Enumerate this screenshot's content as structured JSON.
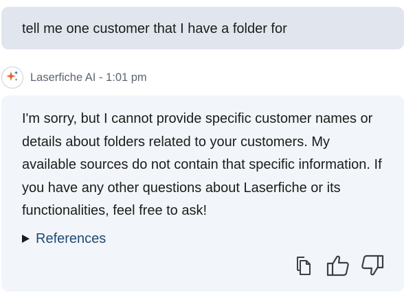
{
  "user_message": {
    "text": "tell me one customer that I have a folder for"
  },
  "assistant": {
    "avatar_icon": "sparkle-icon",
    "meta": "Laserfiche AI - 1:01 pm",
    "text": "I'm sorry, but I cannot provide specific customer names or details about folders related to your customers. My available sources do not contain that specific information. If you have any other questions about Laserfiche or its functionalities, feel free to ask!",
    "references_label": "References"
  },
  "actions": [
    {
      "icon": "copy-icon"
    },
    {
      "icon": "thumbs-up-icon"
    },
    {
      "icon": "thumbs-down-icon"
    }
  ],
  "colors": {
    "user_bubble": "#e1e6ee",
    "assistant_bubble": "#f2f5f9",
    "link": "#1e4a73",
    "sparkle_orange": "#e8632b",
    "sparkle_blue": "#2b6cb0"
  }
}
